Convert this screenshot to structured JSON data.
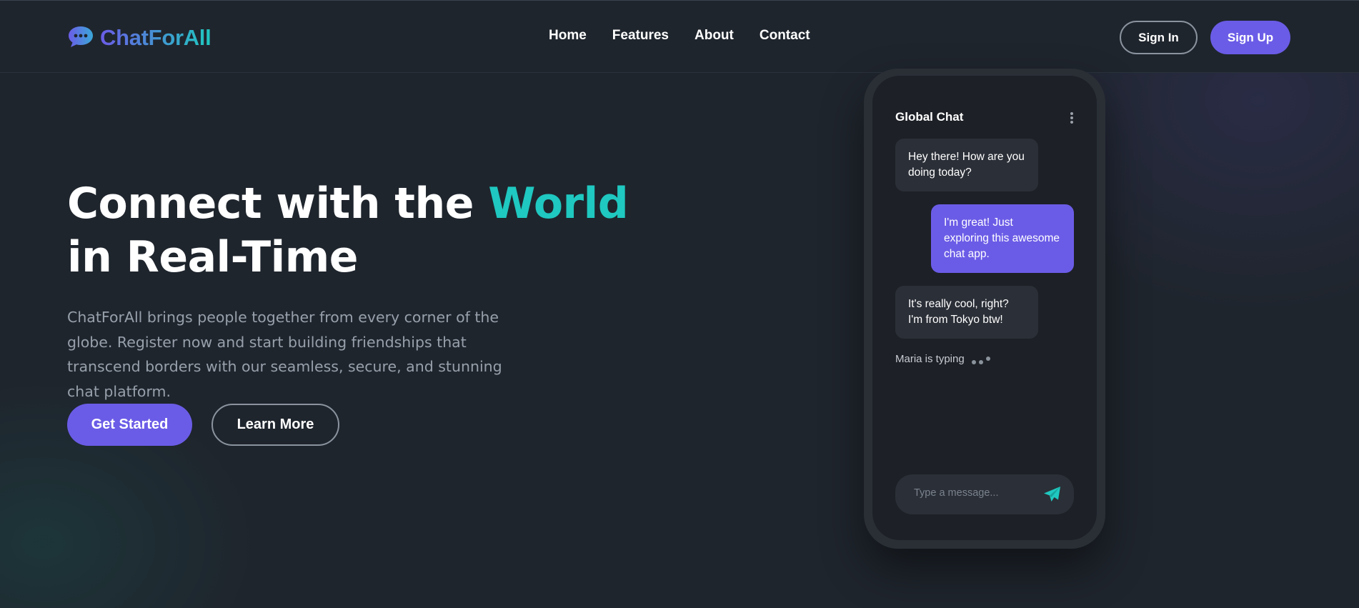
{
  "header": {
    "brand": "ChatForAll",
    "nav": [
      {
        "label": "Home"
      },
      {
        "label": "Features"
      },
      {
        "label": "About"
      },
      {
        "label": "Contact"
      }
    ],
    "signin_label": "Sign In",
    "signup_label": "Sign Up"
  },
  "hero": {
    "title_part1": "Connect with the ",
    "title_accent": "World",
    "title_part2": " in Real-Time",
    "subtitle": "ChatForAll brings people together from every corner of the globe. Register now and start building friendships that transcend borders with our seamless, secure, and stunning chat platform.",
    "primary_cta": "Get Started",
    "secondary_cta": "Learn More"
  },
  "chat": {
    "title": "Global Chat",
    "messages": [
      {
        "direction": "in",
        "text": "Hey there! How are you doing today?"
      },
      {
        "direction": "out",
        "text": "I'm great! Just exploring this awesome chat app."
      },
      {
        "direction": "in",
        "text": "It's really cool, right? I'm from Tokyo btw!"
      }
    ],
    "typing_text": "Maria is typing",
    "input_placeholder": "Type a message..."
  },
  "icons": {
    "logo": "chat-bubble-icon",
    "menu": "more-vertical-icon",
    "send": "send-icon"
  },
  "colors": {
    "background": "#1f252d",
    "accent_purple": "#6b5ce7",
    "accent_teal": "#1fc8c0",
    "muted_text": "#97a0ab"
  }
}
